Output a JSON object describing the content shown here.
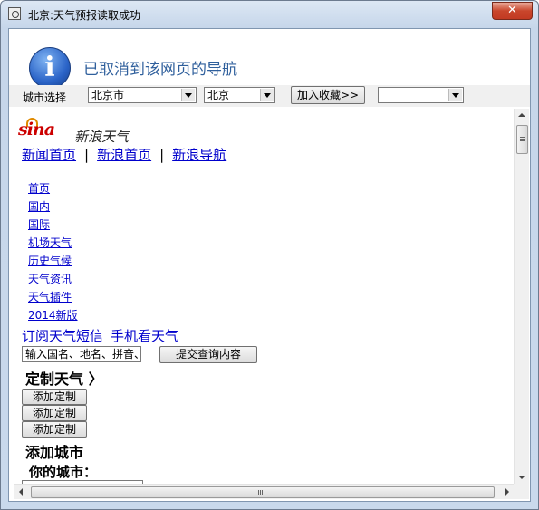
{
  "window": {
    "title": "北京:天气预报读取成功",
    "close_glyph": "✕"
  },
  "banner": {
    "icon": "info-icon",
    "message": "已取消到该网页的导航"
  },
  "toolbar": {
    "city_label": "城市选择",
    "province_value": "北京市",
    "city_value": "北京",
    "favorite_button": "加入收藏>>",
    "favorites_value": ""
  },
  "page": {
    "logo_text": "sina",
    "logo_cn": "新浪天气",
    "top_links": [
      "新闻首页",
      "新浪首页",
      "新浪导航"
    ],
    "separator": "|",
    "nav": [
      "首页",
      "国内",
      "国际",
      "机场天气",
      "历史气候",
      "天气资讯",
      "天气插件",
      "2014新版"
    ],
    "sub_links": [
      "订阅天气短信",
      "手机看天气"
    ],
    "search_placeholder": "输入国名、地名、拼音、",
    "submit_label": "提交查询内容",
    "custom_title": "定制天气 〉",
    "add_buttons": [
      "添加定制",
      "添加定制",
      "添加定制"
    ],
    "add_city_title": "添加城市",
    "your_city_label": "你的城市："
  },
  "scrollbar": {
    "h_grip": "III"
  },
  "colors": {
    "link": "#0000cc",
    "banner_text": "#2f5f9c",
    "close": "#c9462c"
  }
}
